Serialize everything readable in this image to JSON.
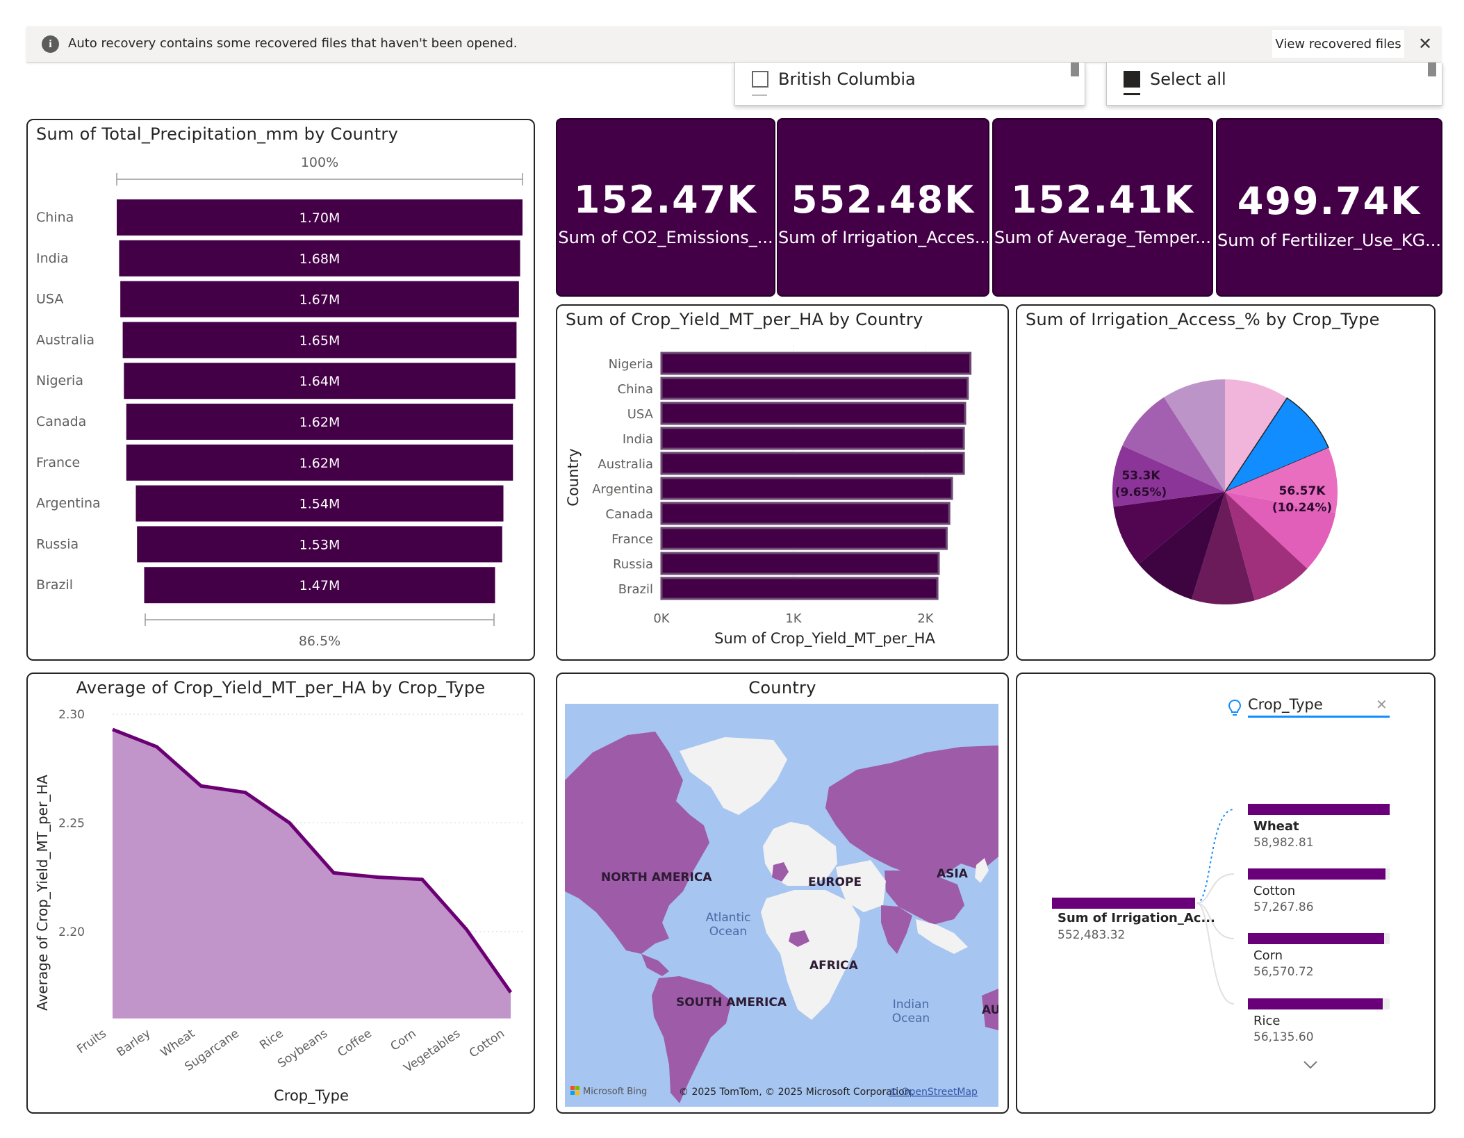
{
  "banner": {
    "message": "Auto recovery contains some recovered files that haven't been opened.",
    "view_button": "View recovered files",
    "info_icon": "info-icon",
    "close_icon": "close-icon"
  },
  "slicers": {
    "region": {
      "option": "British Columbia",
      "checked": false
    },
    "select_all": {
      "option": "Select all",
      "checked": true
    }
  },
  "colors": {
    "purple": "#440047",
    "accent_blue": "#118dff"
  },
  "kpis": [
    {
      "value": "152.47K",
      "label": "Sum of CO2_Emissions_..."
    },
    {
      "value": "552.48K",
      "label": "Sum of Irrigation_Acces..."
    },
    {
      "value": "152.41K",
      "label": "Sum of Average_Temper..."
    },
    {
      "value": "499.74K",
      "label": "Sum of Fertilizer_Use_KG..."
    }
  ],
  "precip": {
    "title": "Sum of Total_Precipitation_mm by Country",
    "top_label": "100%",
    "bottom_label": "86.5%"
  },
  "cropyield": {
    "title": "Sum of Crop_Yield_MT_per_HA by Country"
  },
  "pie": {
    "title": "Sum of Irrigation_Access_% by Crop_Type"
  },
  "avgyield": {
    "title": "Average of Crop_Yield_MT_per_HA by Crop_Type"
  },
  "map": {
    "title": "Country",
    "labels": {
      "north_america": "NORTH AMERICA",
      "europe": "EUROPE",
      "asia": "ASIA",
      "africa": "AFRICA",
      "south_america": "SOUTH AMERICA",
      "atlantic": "Atlantic",
      "ocean": "Ocean",
      "indian": "Indian",
      "au": "AU"
    },
    "brand": "Microsoft Bing",
    "attribution": "© 2025 TomTom, © 2025 Microsoft Corporation,",
    "attribution_link": "© OpenStreetMap"
  },
  "decomp": {
    "field": "Crop_Type",
    "root_label": "Sum of Irrigation_Ac...",
    "root_value": "552,483.32",
    "items": [
      {
        "label": "Wheat",
        "value": "58,982.81",
        "fill": 1.0
      },
      {
        "label": "Cotton",
        "value": "57,267.86",
        "fill": 0.971
      },
      {
        "label": "Corn",
        "value": "56,570.72",
        "fill": 0.959
      },
      {
        "label": "Rice",
        "value": "56,135.60",
        "fill": 0.952
      }
    ]
  },
  "chart_data": [
    {
      "type": "funnel",
      "title": "Sum of Total_Precipitation_mm by Country",
      "categories": [
        "China",
        "India",
        "USA",
        "Australia",
        "Nigeria",
        "Canada",
        "France",
        "Argentina",
        "Russia",
        "Brazil"
      ],
      "values": [
        1.7,
        1.68,
        1.67,
        1.65,
        1.64,
        1.62,
        1.62,
        1.54,
        1.53,
        1.47
      ],
      "value_labels": [
        "1.70M",
        "1.68M",
        "1.67M",
        "1.65M",
        "1.64M",
        "1.62M",
        "1.62M",
        "1.54M",
        "1.53M",
        "1.47M"
      ]
    },
    {
      "type": "bar",
      "title": "Sum of Crop_Yield_MT_per_HA by Country",
      "categories": [
        "Nigeria",
        "China",
        "USA",
        "India",
        "Australia",
        "Argentina",
        "Canada",
        "France",
        "Russia",
        "Brazil"
      ],
      "values": [
        2.34,
        2.32,
        2.3,
        2.29,
        2.29,
        2.2,
        2.18,
        2.16,
        2.1,
        2.09
      ],
      "xlabel": "Sum of Crop_Yield_MT_per_HA",
      "ylabel": "Country",
      "xticks": [
        "0K",
        "1K",
        "2K"
      ],
      "xlim": [
        0,
        2.5
      ]
    },
    {
      "type": "pie",
      "title": "Sum of Irrigation_Access_% by Crop_Type",
      "values": [
        56.57,
        54.0,
        53.0,
        54.5,
        55.0,
        54.0,
        53.3,
        55.0,
        55.0,
        56.0
      ],
      "data_labels": [
        {
          "index": 0,
          "value": "56.57K",
          "percent": "(10.24%)"
        },
        {
          "index": 6,
          "value": "53.3K",
          "percent": "(9.65%)"
        }
      ],
      "colors": [
        "#e96ec0",
        "#e15fb8",
        "#a0307c",
        "#6b1a5a",
        "#3e0442",
        "#520652",
        "#8b3598",
        "#a35fb0",
        "#bc94c7",
        "#f1b5dc",
        "#118dff"
      ],
      "extra_values": [
        56.0
      ]
    },
    {
      "type": "area",
      "title": "Average of Crop_Yield_MT_per_HA by Crop_Type",
      "categories": [
        "Fruits",
        "Barley",
        "Wheat",
        "Sugarcane",
        "Rice",
        "Soybeans",
        "Coffee",
        "Corn",
        "Vegetables",
        "Cotton"
      ],
      "values": [
        2.293,
        2.285,
        2.267,
        2.264,
        2.25,
        2.227,
        2.225,
        2.224,
        2.201,
        2.172
      ],
      "xlabel": "Crop_Type",
      "ylabel": "Average of Crop_Yield_MT_per_HA",
      "yticks": [
        "2.20",
        "2.25",
        "2.30"
      ],
      "ylim": [
        2.16,
        2.3
      ],
      "grid": true
    }
  ]
}
